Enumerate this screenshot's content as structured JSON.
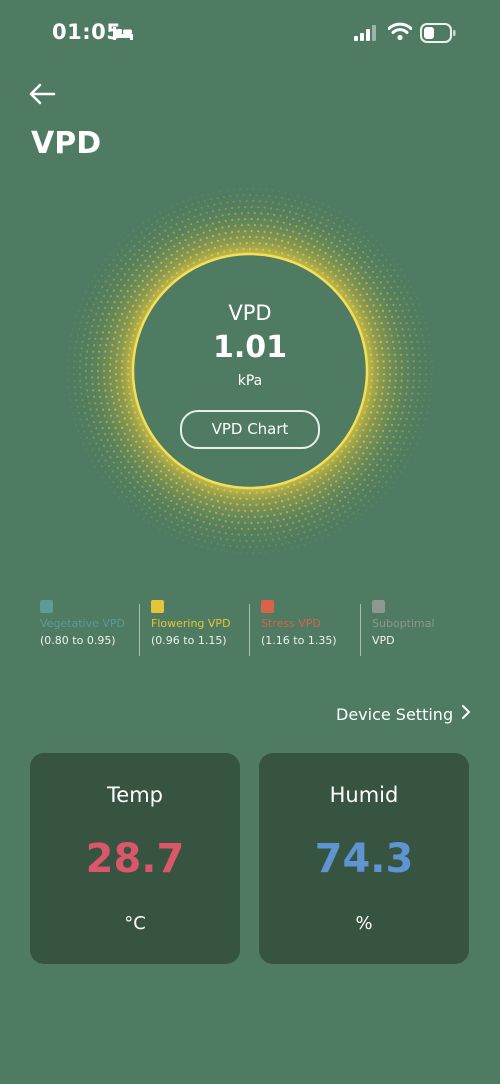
{
  "status_bar": {
    "time": "01:05"
  },
  "header": {
    "title": "VPD"
  },
  "gauge": {
    "title": "VPD",
    "value": "1.01",
    "unit": "kPa",
    "chart_button_label": "VPD Chart",
    "ring_color": "#e6c43a"
  },
  "legend": [
    {
      "name": "Vegetative VPD",
      "range": "(0.80 to 0.95)",
      "color": "#5e9b97"
    },
    {
      "name": "Flowering VPD",
      "range": "(0.96 to 1.15)",
      "color": "#e6c43a"
    },
    {
      "name": "Stress VPD",
      "range": "(1.16 to 1.35)",
      "color": "#d8634a"
    },
    {
      "name": "Suboptimal",
      "range": "VPD",
      "color": "#8e9790"
    }
  ],
  "device_setting_label": "Device Setting",
  "cards": {
    "temp": {
      "label": "Temp",
      "value": "28.7",
      "unit": "°C",
      "color": "#d9566b"
    },
    "humid": {
      "label": "Humid",
      "value": "74.3",
      "unit": "%",
      "color": "#5f94d2"
    }
  }
}
